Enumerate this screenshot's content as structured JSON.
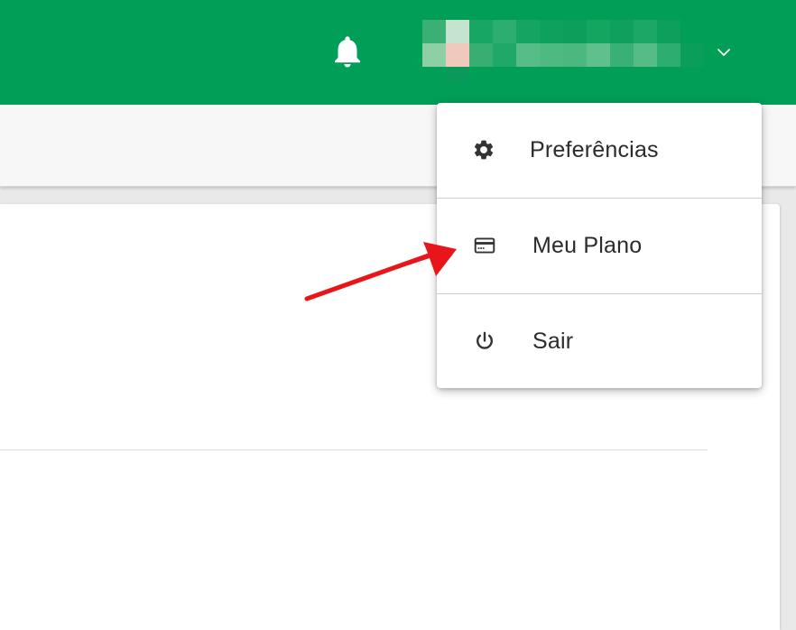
{
  "header": {
    "bell_icon": "bell-icon",
    "user_avatar": "pixelated-user-name",
    "chevron_icon": "chevron-down-icon",
    "brand_color": "#009e57"
  },
  "user_menu": {
    "items": [
      {
        "label": "Preferências",
        "icon": "gear-icon"
      },
      {
        "label": "Meu Plano",
        "icon": "credit-card-icon"
      },
      {
        "label": "Sair",
        "icon": "power-icon"
      }
    ]
  },
  "annotation": {
    "arrow_color": "#e8161b",
    "points_to": "Meu Plano"
  }
}
